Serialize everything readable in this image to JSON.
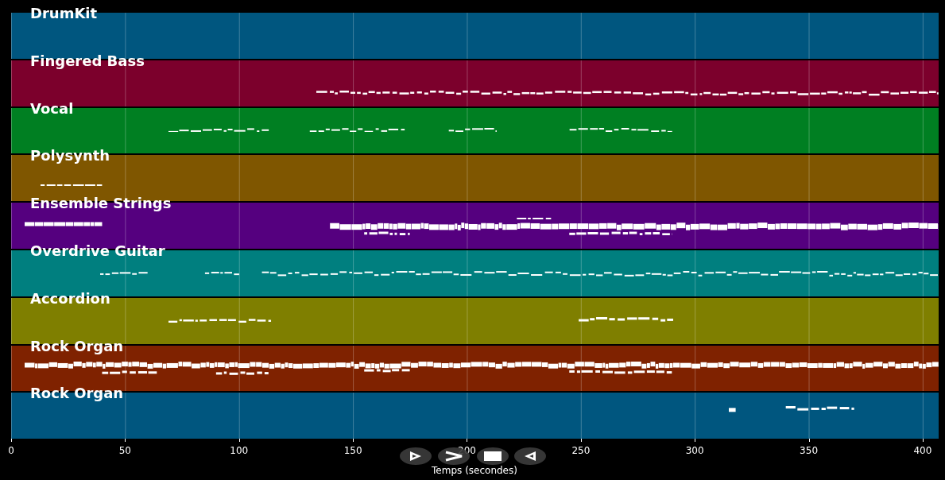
{
  "tracks": [
    {
      "name": "DrumKit",
      "color": "#00567f"
    },
    {
      "name": "Fingered Bass",
      "color": "#7c002c"
    },
    {
      "name": "Vocal",
      "color": "#007f22"
    },
    {
      "name": "Polysynth",
      "color": "#7f5600"
    },
    {
      "name": "Ensemble Strings",
      "color": "#55007f"
    },
    {
      "name": "Overdrive Guitar",
      "color": "#007f7f"
    },
    {
      "name": "Accordion",
      "color": "#7f7f00"
    },
    {
      "name": "Rock Organ",
      "color": "#7f2200"
    },
    {
      "name": "Rock Organ",
      "color": "#00567f"
    }
  ],
  "x_axis": {
    "ticks": [
      "0",
      "50",
      "100",
      "150",
      "200",
      "250",
      "300",
      "350",
      "400"
    ],
    "label": "Temps (secondes)"
  }
}
